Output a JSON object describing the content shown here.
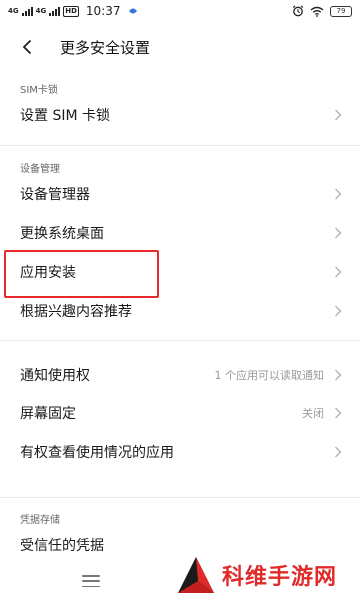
{
  "status_bar": {
    "network_1": "4G",
    "network_2": "4G",
    "hd_badge": "HD",
    "time": "10:37",
    "battery_level": "79"
  },
  "header": {
    "title": "更多安全设置"
  },
  "sections": [
    {
      "label": "SIM卡锁",
      "items": [
        {
          "label": "设置 SIM 卡锁"
        }
      ]
    },
    {
      "label": "设备管理",
      "items": [
        {
          "label": "设备管理器"
        },
        {
          "label": "更换系统桌面"
        },
        {
          "label": "应用安装"
        },
        {
          "label": "根据兴趣内容推荐"
        }
      ]
    },
    {
      "label": "",
      "items": [
        {
          "label": "通知使用权",
          "value": "1 个应用可以读取通知"
        },
        {
          "label": "屏幕固定",
          "value": "关闭"
        },
        {
          "label": "有权查看使用情况的应用"
        }
      ]
    },
    {
      "label": "凭据存储",
      "items": [
        {
          "label": "受信任的凭据"
        }
      ]
    }
  ],
  "watermark": {
    "text": "科维手游网"
  },
  "colors": {
    "highlight": "#e8282a",
    "watermark": "#e02b2b",
    "chevron": "#b0b0b0"
  }
}
